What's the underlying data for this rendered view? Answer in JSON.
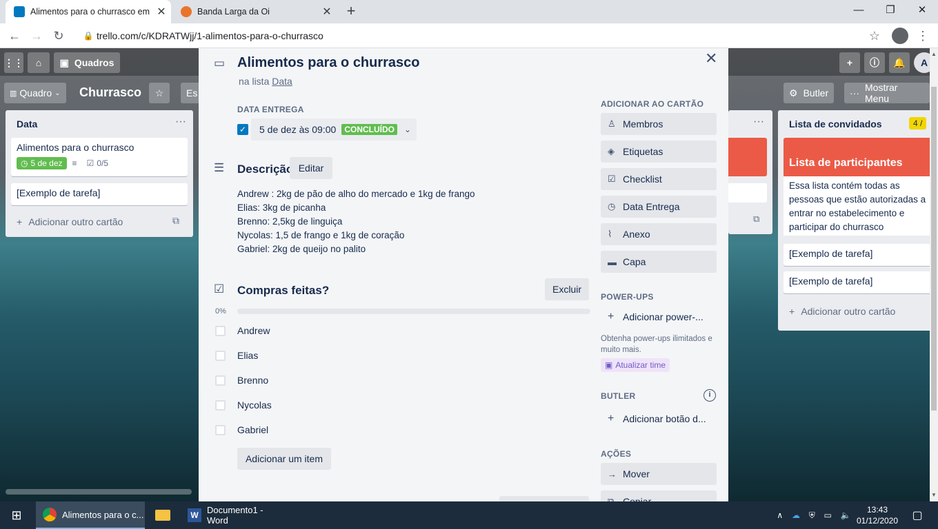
{
  "browser": {
    "tabs": [
      {
        "title": "Alimentos para o churrasco em C",
        "close": "✕"
      },
      {
        "title": "Banda Larga da Oi",
        "close": "✕"
      }
    ],
    "new_tab": "+",
    "url": "trello.com/c/KDRATWjj/1-alimentos-para-o-churrasco",
    "window_controls": {
      "minimize": "—",
      "maximize": "❐",
      "close": "✕"
    }
  },
  "board_header": {
    "boards_label": "Quadros",
    "avatar_initial": "A"
  },
  "board_bar": {
    "view_label": "Quadro",
    "board_title": "Churrasco",
    "partial_label": "Es",
    "butler_label": "Butler",
    "show_menu_label": "Mostrar Menu"
  },
  "lists": {
    "data": {
      "title": "Data",
      "cards": [
        {
          "title": "Alimentos para o churrasco",
          "due_badge": "5 de dez",
          "checklist": "0/5"
        },
        {
          "title": "[Exemplo de tarefa]"
        }
      ],
      "add_card": "Adicionar outro cartão"
    },
    "guests": {
      "title": "Lista de convidados",
      "count": "4 /",
      "cover_title": "Lista de participantes",
      "description": "Essa lista contém todas as pessoas que estão autorizadas a entrar no estabelecimento e participar do churrasco",
      "cards": [
        "[Exemplo de tarefa]",
        "[Exemplo de tarefa]"
      ],
      "add_card": "Adicionar outro cartão"
    }
  },
  "card_modal": {
    "title": "Alimentos para o churrasco",
    "in_list_prefix": "na lista",
    "list_name": "Data",
    "due_label": "DATA ENTREGA",
    "due_value": "5 de dez às 09:00",
    "due_status": "CONCLUÍDO",
    "description_label": "Descrição",
    "edit_label": "Editar",
    "description_lines": [
      "Andrew : 2kg de pão de alho do mercado e 1kg de frango",
      "Elias: 3kg de picanha",
      "Brenno: 2,5kg de linguiça",
      "Nycolas: 1,5 de frango e 1kg de coração",
      "Gabriel: 2kg de queijo no palito"
    ],
    "checklist_title": "Compras feitas?",
    "delete_label": "Excluir",
    "progress_label": "0%",
    "progress": 0,
    "checklist_items": [
      "Andrew",
      "Elias",
      "Brenno",
      "Nycolas",
      "Gabriel"
    ],
    "add_item_label": "Adicionar um item"
  },
  "sidebar": {
    "add_to_card_label": "ADICIONAR AO CARTÃO",
    "add_to_card": [
      "Membros",
      "Etiquetas",
      "Checklist",
      "Data Entrega",
      "Anexo",
      "Capa"
    ],
    "powerups_label": "POWER-UPS",
    "add_powerup": "Adicionar power-...",
    "powerups_note": "Obtenha power-ups ilimitados e muito mais.",
    "upgrade_label": "Atualizar time",
    "butler_label": "BUTLER",
    "add_butler": "Adicionar botão d...",
    "actions_label": "AÇÕES",
    "move_label": "Mover",
    "copy_label": "Copiar"
  },
  "taskbar": {
    "chrome_label": "Alimentos para o c...",
    "word_label": "Documento1 - Word",
    "time": "13:43",
    "date": "01/12/2020"
  },
  "colors": {
    "trello_blue": "#0079bf",
    "green": "#61bd4f",
    "red_cover": "#eb5a46",
    "orange_list": "#fad29c"
  }
}
